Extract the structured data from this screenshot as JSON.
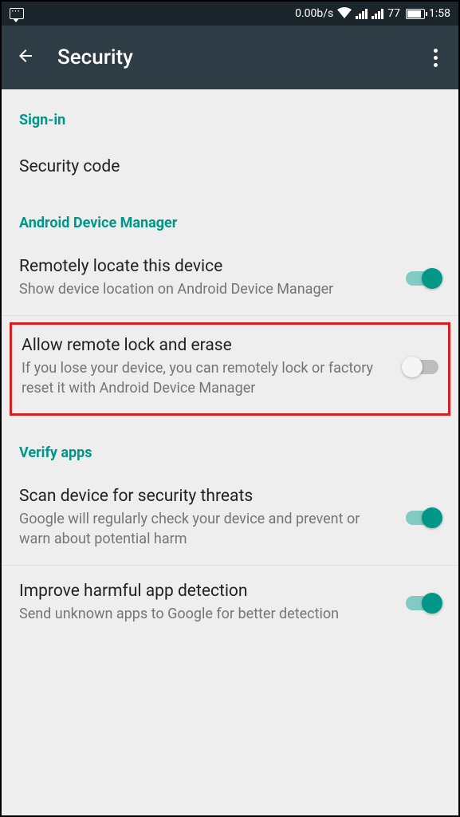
{
  "status_bar": {
    "data_rate": "0.00b/s",
    "battery_percent": "77",
    "time": "1:58"
  },
  "app_bar": {
    "title": "Security"
  },
  "sections": {
    "signin": {
      "header": "Sign-in",
      "items": {
        "security_code": "Security code"
      }
    },
    "adm": {
      "header": "Android Device Manager",
      "items": {
        "locate": {
          "title": "Remotely locate this device",
          "subtitle": "Show device location on Android Device Manager",
          "enabled": true
        },
        "lock_erase": {
          "title": "Allow remote lock and erase",
          "subtitle": "If you lose your device, you can remotely lock or factory reset it with Android Device Manager",
          "enabled": false
        }
      }
    },
    "verify": {
      "header": "Verify apps",
      "items": {
        "scan": {
          "title": "Scan device for security threats",
          "subtitle": "Google will regularly check your device and prevent or warn about potential harm",
          "enabled": true
        },
        "improve": {
          "title": "Improve harmful app detection",
          "subtitle": "Send unknown apps to Google for better detection",
          "enabled": true
        }
      }
    }
  }
}
